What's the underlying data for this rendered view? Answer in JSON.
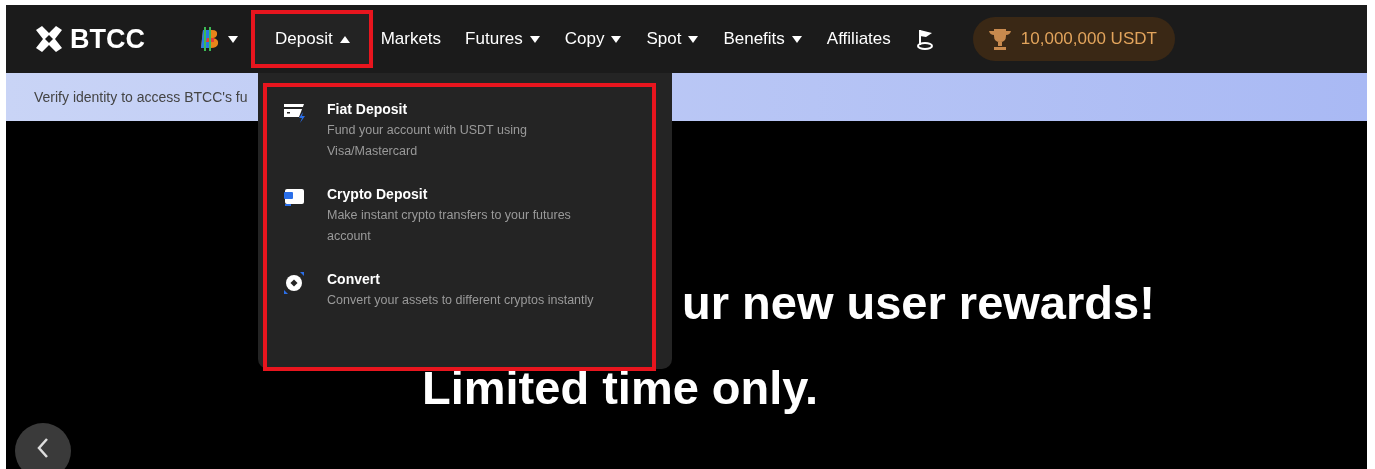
{
  "logo": {
    "text": "BTCC"
  },
  "nav": [
    {
      "kind": "coin",
      "dropdown": true,
      "expanded": false,
      "highlighted": false
    },
    {
      "kind": "text",
      "label": "Deposit",
      "dropdown": true,
      "expanded": true,
      "highlighted": true
    },
    {
      "kind": "text",
      "label": "Markets",
      "dropdown": false,
      "highlighted": false
    },
    {
      "kind": "text",
      "label": "Futures",
      "dropdown": true,
      "expanded": false,
      "highlighted": false
    },
    {
      "kind": "text",
      "label": "Copy",
      "dropdown": true,
      "expanded": false,
      "highlighted": false
    },
    {
      "kind": "text",
      "label": "Spot",
      "dropdown": true,
      "expanded": false,
      "highlighted": false
    },
    {
      "kind": "text",
      "label": "Benefits",
      "dropdown": true,
      "expanded": false,
      "highlighted": false
    },
    {
      "kind": "text",
      "label": "Affiliates",
      "dropdown": false,
      "highlighted": false
    },
    {
      "kind": "flag",
      "dropdown": false,
      "highlighted": false
    }
  ],
  "reward_pill": {
    "text": "10,000,000 USDT"
  },
  "banner": {
    "text": "Verify identity to access BTCC's fu"
  },
  "deposit_menu": {
    "highlighted": true,
    "items": [
      {
        "kind": "fiat",
        "title": "Fiat Deposit",
        "description": "Fund your account with USDT using Visa/Mastercard"
      },
      {
        "kind": "crypto",
        "title": "Crypto Deposit",
        "description": "Make instant crypto transfers to your futures account"
      },
      {
        "kind": "convert",
        "title": "Convert",
        "description": "Convert your assets to different cryptos instantly"
      }
    ]
  },
  "hero": {
    "lines": [
      "ur new user rewards!",
      "Limited time only."
    ]
  }
}
